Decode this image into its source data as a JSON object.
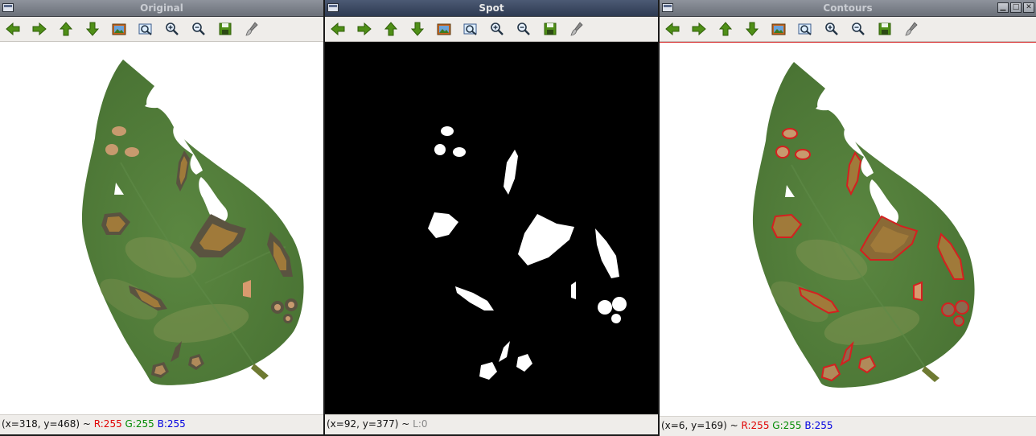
{
  "windows": [
    {
      "title": "Original",
      "status": {
        "coords": "(x=318, y=468) ~ ",
        "r": "R:255",
        "g": "G:255",
        "b": "B:255"
      }
    },
    {
      "title": "Spot",
      "status": {
        "coords": "(x=92, y=377) ~ ",
        "l": "L:0"
      }
    },
    {
      "title": "Contours",
      "status": {
        "coords": "(x=6, y=169) ~ ",
        "r": "R:255",
        "g": "G:255",
        "b": "B:255"
      }
    }
  ],
  "toolbar_icons": [
    "arrow-left-icon",
    "arrow-right-icon",
    "arrow-up-icon",
    "arrow-down-icon",
    "image-icon",
    "zoom-fit-icon",
    "zoom-in-icon",
    "zoom-out-icon",
    "save-icon",
    "brush-icon"
  ],
  "colors": {
    "leaf": "#4d7a37",
    "spot_fill": "#a07a3a",
    "spot_halo": "#5a5340",
    "contour": "#d42020"
  }
}
